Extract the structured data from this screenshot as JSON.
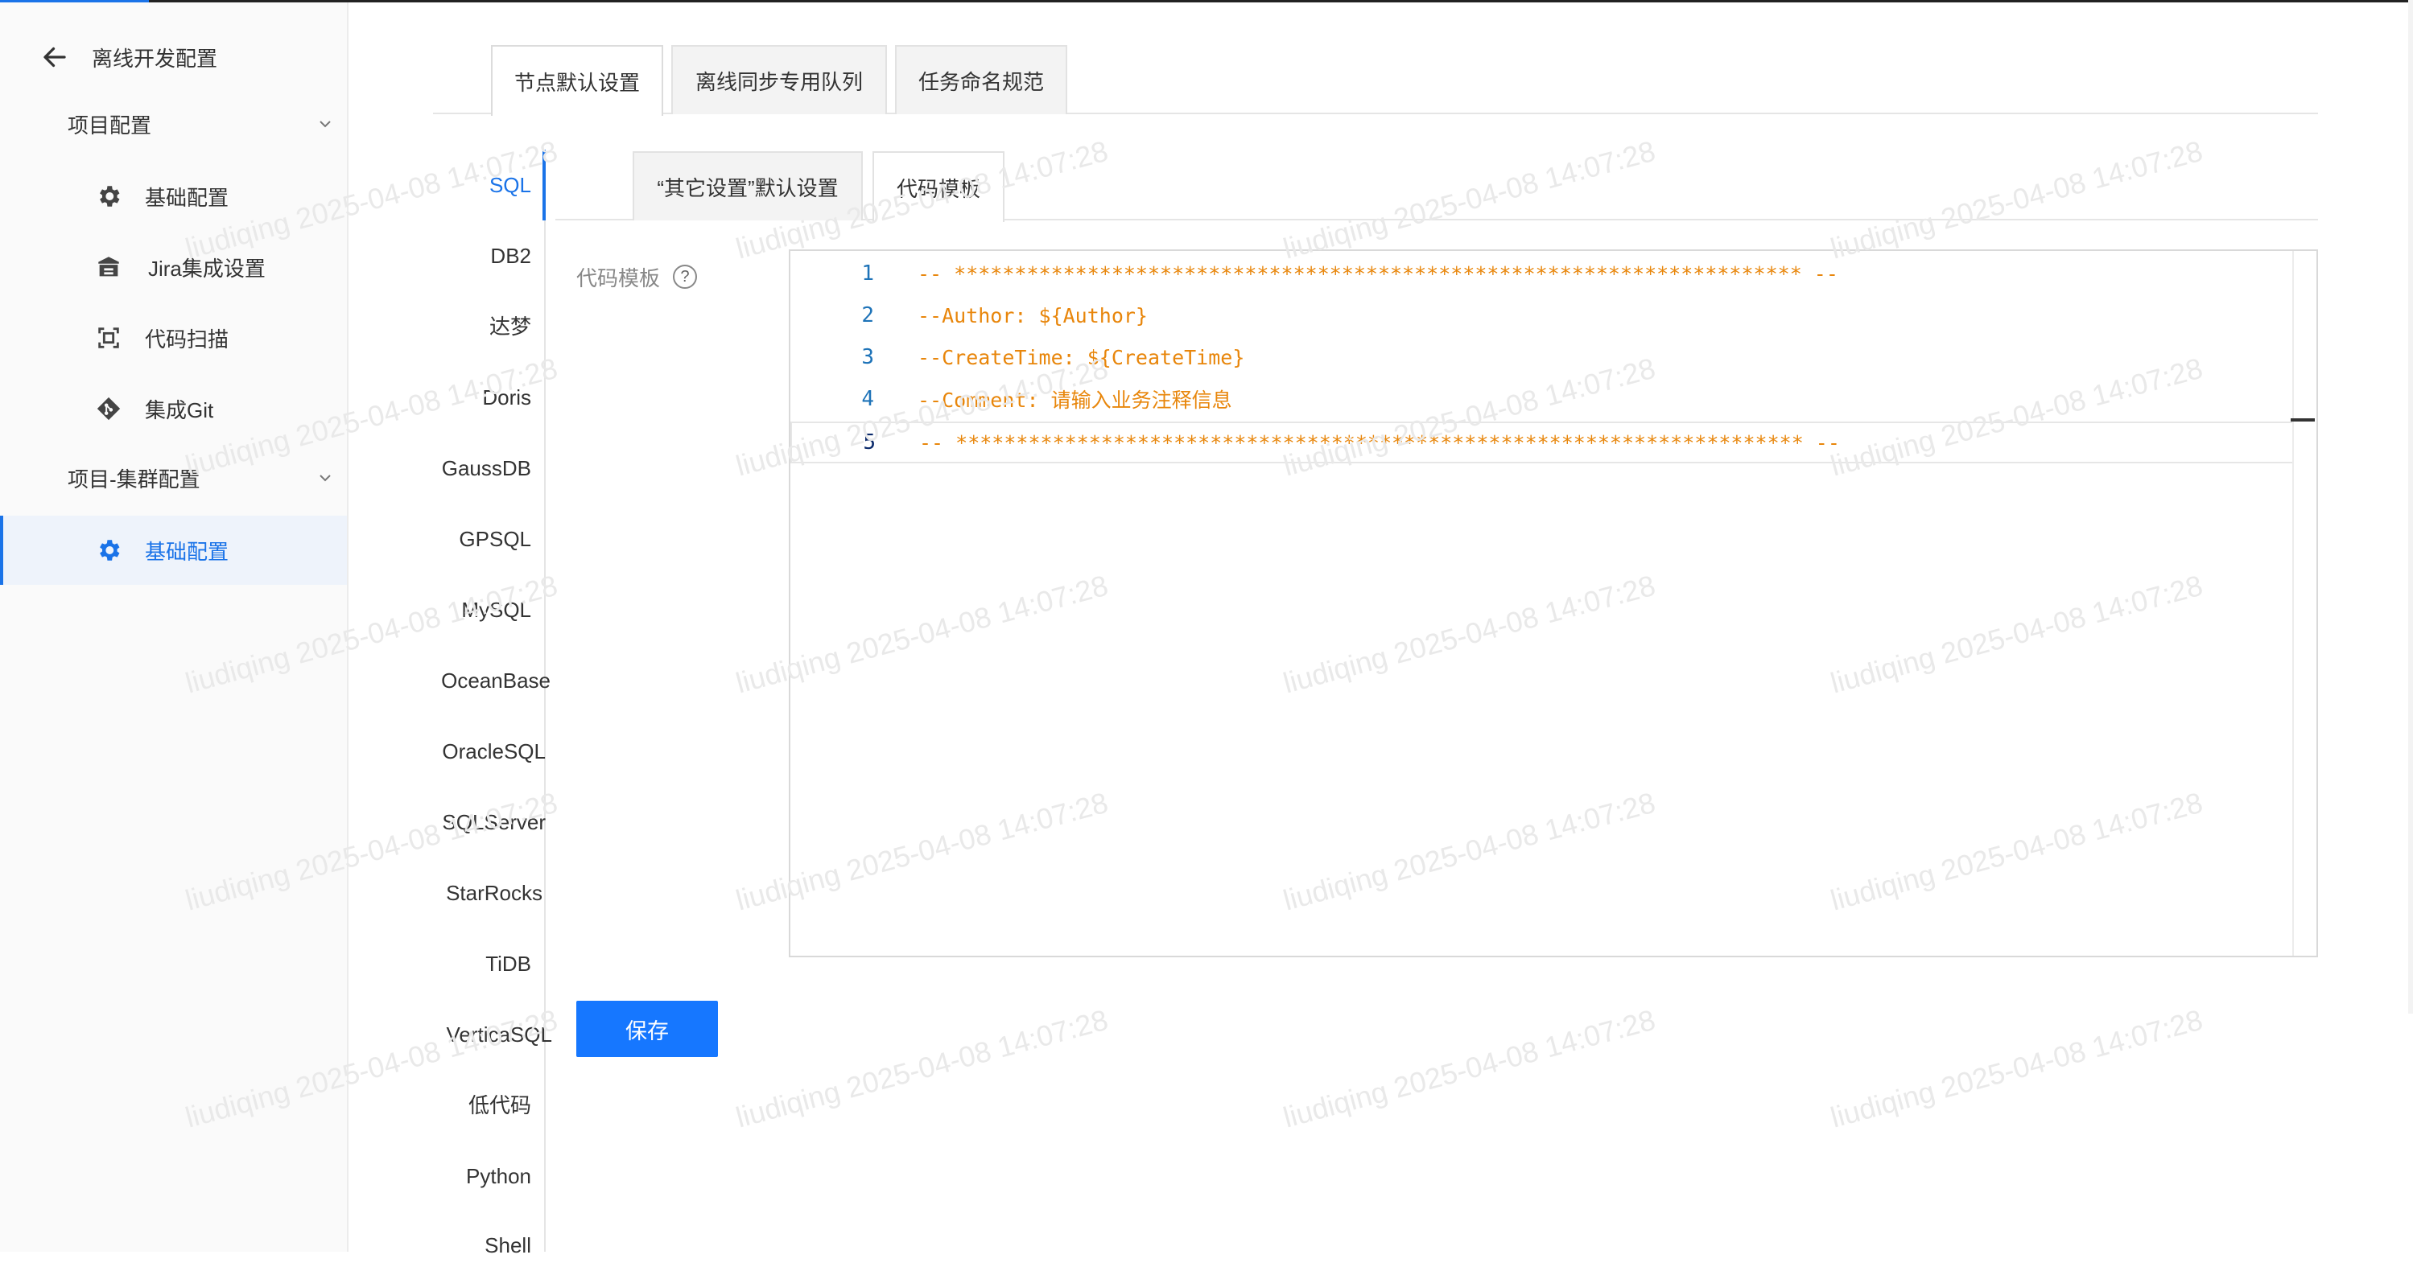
{
  "sidebar": {
    "back_label": "离线开发配置",
    "groups": [
      {
        "title": "项目配置",
        "items": [
          {
            "label": "基础配置",
            "icon": "gear-icon"
          },
          {
            "label": "Jira集成设置",
            "icon": "jira-icon"
          },
          {
            "label": "代码扫描",
            "icon": "scan-icon"
          },
          {
            "label": "集成Git",
            "icon": "git-icon"
          }
        ]
      },
      {
        "title": "项目-集群配置",
        "items": [
          {
            "label": "基础配置",
            "icon": "gear-icon",
            "active": true
          }
        ]
      }
    ]
  },
  "top_tabs": [
    "节点默认设置",
    "离线同步专用队列",
    "任务命名规范"
  ],
  "db_types": [
    "SQL",
    "DB2",
    "达梦",
    "Doris",
    "GaussDB",
    "GPSQL",
    "MySQL",
    "OceanBase",
    "OracleSQL",
    "SQLServer",
    "StarRocks",
    "TiDB",
    "VerticaSQL",
    "低代码",
    "Python",
    "Shell"
  ],
  "sub_tabs": [
    "“其它设置”默认设置",
    "代码模板"
  ],
  "form": {
    "label": "代码模板",
    "help": "?"
  },
  "editor": {
    "lines": [
      {
        "no": "1",
        "text": "-- ********************************************************************** --"
      },
      {
        "no": "2",
        "text": "--Author: ${Author}"
      },
      {
        "no": "3",
        "text": "--CreateTime: ${CreateTime}"
      },
      {
        "no": "4",
        "text": "--Comment: 请输入业务注释信息"
      },
      {
        "no": "5",
        "text": "-- ********************************************************************** --"
      }
    ]
  },
  "save_label": "保存",
  "watermark": "liudiqing 2025-04-08 14:07:28",
  "colors": {
    "accent": "#1a73e8",
    "button": "#1677ff",
    "code": "#e8860b"
  }
}
